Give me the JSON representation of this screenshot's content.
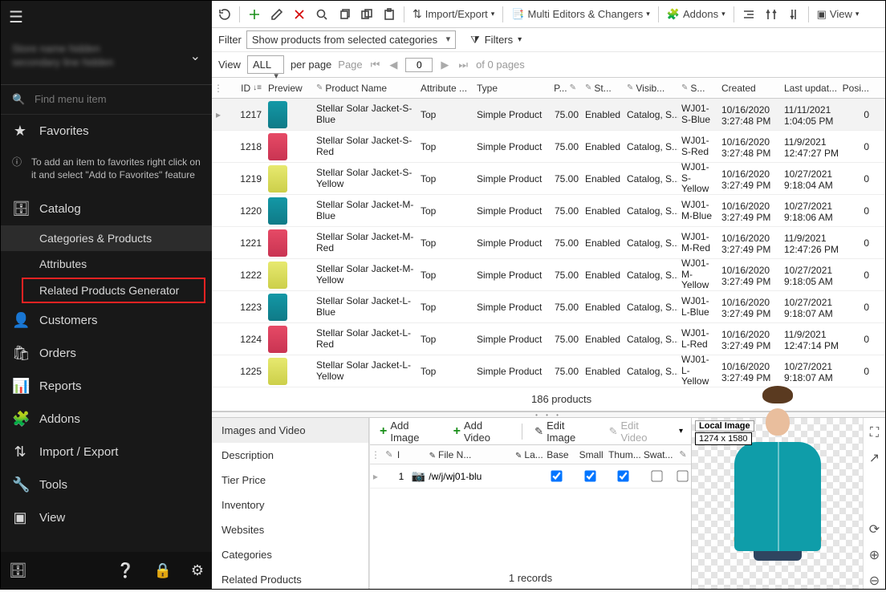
{
  "sidebar": {
    "search_placeholder": "Find menu item",
    "favorites": "Favorites",
    "favorites_hint": "To add an item to favorites right click on it and select \"Add to Favorites\" feature",
    "catalog": "Catalog",
    "cat_sub": [
      "Categories & Products",
      "Attributes",
      "Related Products Generator"
    ],
    "customers": "Customers",
    "orders": "Orders",
    "reports": "Reports",
    "addons": "Addons",
    "import_export": "Import / Export",
    "tools": "Tools",
    "view": "View"
  },
  "filter": {
    "label": "Filter",
    "value": "Show products from selected categories",
    "filters_label": "Filters"
  },
  "pager": {
    "view": "View",
    "all": "ALL",
    "per_page": "per page",
    "page": "Page",
    "value": "0",
    "of": "of 0 pages"
  },
  "toolbar": {
    "import_export": "Import/Export",
    "multi_editors": "Multi Editors & Changers",
    "addons": "Addons",
    "view": "View"
  },
  "grid": {
    "headers": {
      "id": "ID",
      "preview": "Preview",
      "name": "Product Name",
      "attr": "Attribute ...",
      "type": "Type",
      "price": "P...",
      "status": "St...",
      "visib": "Visib...",
      "sku": "S...",
      "created": "Created",
      "upd": "Last updat...",
      "pos": "Posi..."
    },
    "rows": [
      {
        "id": "1217",
        "color": "blue",
        "name": "Stellar Solar Jacket-S-Blue",
        "attr": "Top",
        "type": "Simple Product",
        "price": "75.00",
        "status": "Enabled",
        "visib": "Catalog, S...",
        "sku": "WJ01-S-Blue",
        "created": "10/16/2020 3:27:48 PM",
        "upd": "11/11/2021 1:04:05 PM",
        "pos": "0"
      },
      {
        "id": "1218",
        "color": "red",
        "name": "Stellar Solar Jacket-S-Red",
        "attr": "Top",
        "type": "Simple Product",
        "price": "75.00",
        "status": "Enabled",
        "visib": "Catalog, S...",
        "sku": "WJ01-S-Red",
        "created": "10/16/2020 3:27:48 PM",
        "upd": "11/9/2021 12:47:27 PM",
        "pos": "0"
      },
      {
        "id": "1219",
        "color": "yellow",
        "name": "Stellar Solar Jacket-S-Yellow",
        "attr": "Top",
        "type": "Simple Product",
        "price": "75.00",
        "status": "Enabled",
        "visib": "Catalog, S...",
        "sku": "WJ01-S-Yellow",
        "created": "10/16/2020 3:27:49 PM",
        "upd": "10/27/2021 9:18:04 AM",
        "pos": "0"
      },
      {
        "id": "1220",
        "color": "blue",
        "name": "Stellar Solar Jacket-M-Blue",
        "attr": "Top",
        "type": "Simple Product",
        "price": "75.00",
        "status": "Enabled",
        "visib": "Catalog, S...",
        "sku": "WJ01-M-Blue",
        "created": "10/16/2020 3:27:49 PM",
        "upd": "10/27/2021 9:18:06 AM",
        "pos": "0"
      },
      {
        "id": "1221",
        "color": "red",
        "name": "Stellar Solar Jacket-M-Red",
        "attr": "Top",
        "type": "Simple Product",
        "price": "75.00",
        "status": "Enabled",
        "visib": "Catalog, S...",
        "sku": "WJ01-M-Red",
        "created": "10/16/2020 3:27:49 PM",
        "upd": "11/9/2021 12:47:26 PM",
        "pos": "0"
      },
      {
        "id": "1222",
        "color": "yellow",
        "name": "Stellar Solar Jacket-M-Yellow",
        "attr": "Top",
        "type": "Simple Product",
        "price": "75.00",
        "status": "Enabled",
        "visib": "Catalog, S...",
        "sku": "WJ01-M-Yellow",
        "created": "10/16/2020 3:27:49 PM",
        "upd": "10/27/2021 9:18:05 AM",
        "pos": "0"
      },
      {
        "id": "1223",
        "color": "blue",
        "name": "Stellar Solar Jacket-L-Blue",
        "attr": "Top",
        "type": "Simple Product",
        "price": "75.00",
        "status": "Enabled",
        "visib": "Catalog, S...",
        "sku": "WJ01-L-Blue",
        "created": "10/16/2020 3:27:49 PM",
        "upd": "10/27/2021 9:18:07 AM",
        "pos": "0"
      },
      {
        "id": "1224",
        "color": "red",
        "name": "Stellar Solar Jacket-L-Red",
        "attr": "Top",
        "type": "Simple Product",
        "price": "75.00",
        "status": "Enabled",
        "visib": "Catalog, S...",
        "sku": "WJ01-L-Red",
        "created": "10/16/2020 3:27:49 PM",
        "upd": "11/9/2021 12:47:14 PM",
        "pos": "0"
      },
      {
        "id": "1225",
        "color": "yellow",
        "name": "Stellar Solar Jacket-L-Yellow",
        "attr": "Top",
        "type": "Simple Product",
        "price": "75.00",
        "status": "Enabled",
        "visib": "Catalog, S...",
        "sku": "WJ01-L-Yellow",
        "created": "10/16/2020 3:27:49 PM",
        "upd": "10/27/2021 9:18:07 AM",
        "pos": "0"
      }
    ],
    "footer": "186 products"
  },
  "tabs": [
    "Images and Video",
    "Description",
    "Tier Price",
    "Inventory",
    "Websites",
    "Categories",
    "Related Products"
  ],
  "detail": {
    "add_image": "Add Image",
    "add_video": "Add Video",
    "edit_image": "Edit Image",
    "edit_video": "Edit Video",
    "headers": {
      "i": "I",
      "file": "File N...",
      "label": "La...",
      "base": "Base",
      "small": "Small",
      "thumb": "Thum...",
      "swat": "Swat..."
    },
    "row": {
      "idx": "1",
      "file": "/w/j/wj01-blu",
      "base": true,
      "small": true,
      "thumb": true,
      "swatch": false,
      "extra": false
    },
    "footer": "1 records"
  },
  "image": {
    "label": "Local Image",
    "dims": "1274 x 1580"
  }
}
